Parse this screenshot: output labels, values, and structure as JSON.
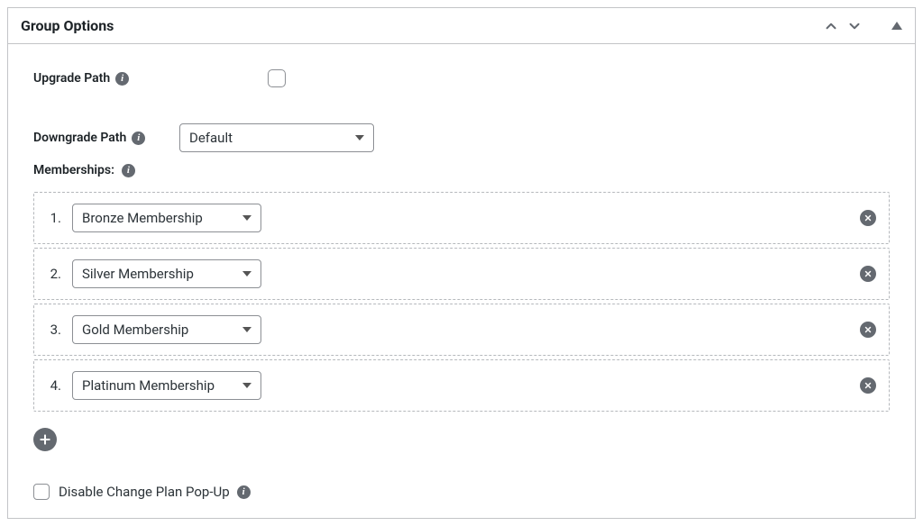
{
  "panel": {
    "title": "Group Options"
  },
  "upgrade": {
    "label": "Upgrade Path"
  },
  "downgrade": {
    "label": "Downgrade Path",
    "select_value": "Default"
  },
  "memberships": {
    "label": "Memberships:",
    "rows": [
      {
        "num": "1.",
        "value": "Bronze Membership"
      },
      {
        "num": "2.",
        "value": "Silver Membership"
      },
      {
        "num": "3.",
        "value": "Gold Membership"
      },
      {
        "num": "4.",
        "value": "Platinum Membership"
      }
    ]
  },
  "disable": {
    "label": "Disable Change Plan Pop-Up"
  },
  "info_glyph": "i"
}
